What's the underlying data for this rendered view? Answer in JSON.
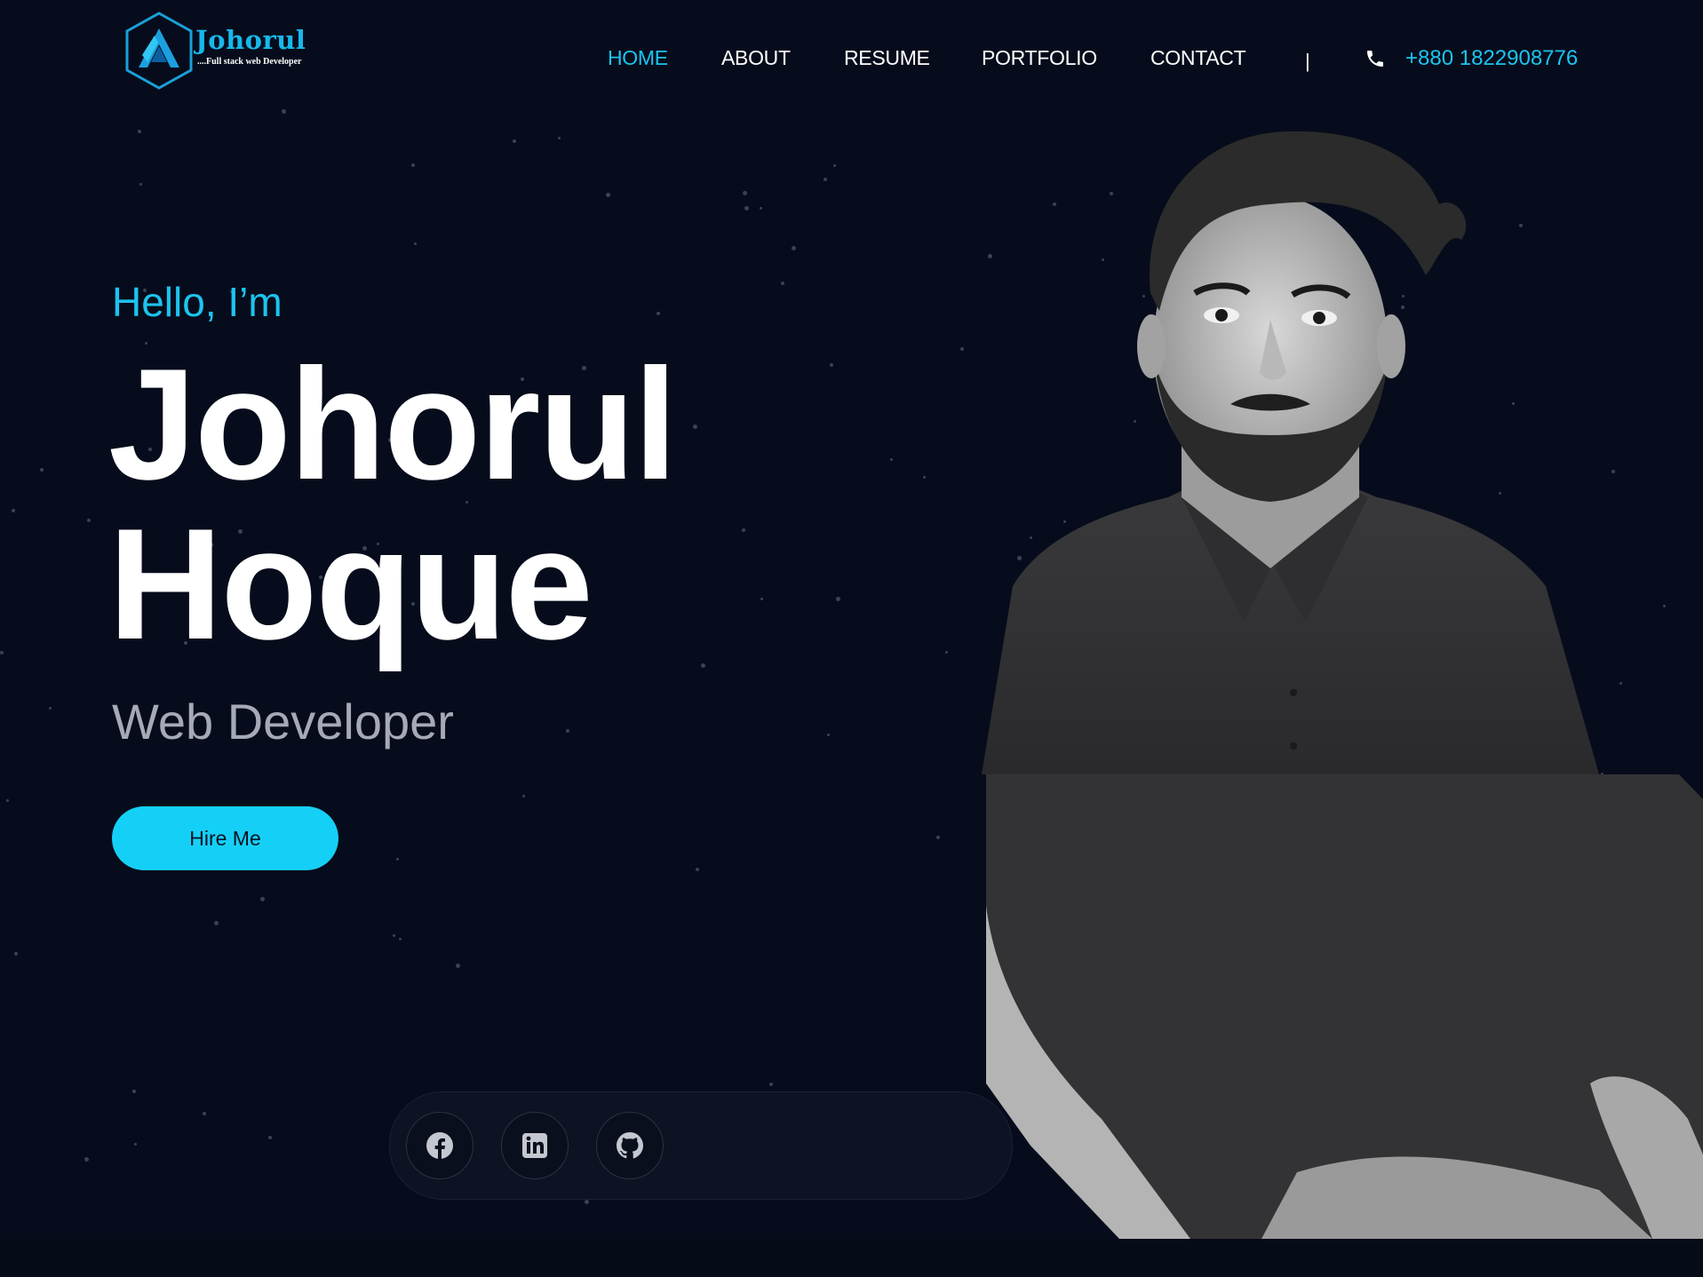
{
  "logo": {
    "title": "Johorul",
    "subtitle": "....Full stack web Developer"
  },
  "nav": {
    "items": [
      {
        "label": "HOME",
        "active": true
      },
      {
        "label": "ABOUT",
        "active": false
      },
      {
        "label": "RESUME",
        "active": false
      },
      {
        "label": "PORTFOLIO",
        "active": false
      },
      {
        "label": "CONTACT",
        "active": false
      }
    ],
    "divider": "|",
    "phone_icon": "phone-icon",
    "phone": "+880 1822908776"
  },
  "hero": {
    "greeting": "Hello, I’m",
    "first_name": "Johorul",
    "last_name": "Hoque",
    "role": "Web Developer",
    "cta_label": "Hire Me"
  },
  "social": {
    "links": [
      {
        "icon": "facebook-icon",
        "name": "Facebook"
      },
      {
        "icon": "linkedin-icon",
        "name": "LinkedIn"
      },
      {
        "icon": "github-icon",
        "name": "GitHub"
      }
    ]
  },
  "colors": {
    "background": "#070c1c",
    "accent": "#1cc4ee",
    "button": "#15d0f6",
    "text": "#ffffff",
    "muted_text": "#a7aab6"
  }
}
